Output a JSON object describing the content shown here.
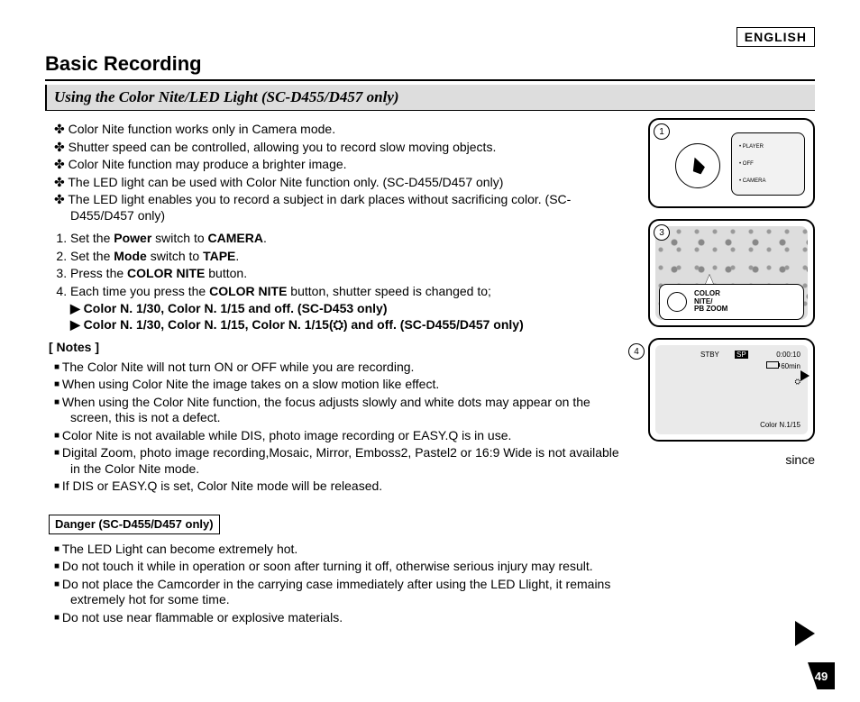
{
  "lang_label": "ENGLISH",
  "title": "Basic Recording",
  "subhead": "Using the Color Nite/LED Light (SC-D455/D457 only)",
  "intro_bullets": [
    "Color Nite function works only in Camera mode.",
    "Shutter speed can be controlled, allowing you to record slow moving objects.",
    "Color Nite function may produce a brighter image.",
    "The LED light can be used with Color Nite function only. (SC-D455/D457 only)",
    "The LED light enables you to record a subject in dark places without sacrificing color. (SC-D455/D457 only)"
  ],
  "steps": [
    {
      "pre": "Set the ",
      "b1": "Power",
      "mid": " switch to ",
      "b2": "CAMERA",
      "post": "."
    },
    {
      "pre": "Set the ",
      "b1": "Mode",
      "mid": " switch to ",
      "b2": "TAPE",
      "post": "."
    },
    {
      "pre": "Press the ",
      "b1": "COLOR NITE",
      "mid": "",
      "b2": "",
      "post": " button."
    },
    {
      "pre": "Each time you press the ",
      "b1": "COLOR NITE",
      "mid": "",
      "b2": "",
      "post": " button, shutter speed is changed to;"
    }
  ],
  "step4_sub": [
    "▶ Color N. 1/30, Color N. 1/15 and off. (SC-D453 only)",
    "▶ Color N. 1/30, Color N. 1/15, Color N. 1/15(⛭) and off. (SC-D455/D457 only)"
  ],
  "notes_head": "[ Notes ]",
  "notes": [
    "The Color Nite will not turn ON or OFF while you are recording.",
    "When using Color Nite the image takes on a slow motion like effect.",
    "When using the Color Nite function, the focus adjusts slowly and white dots may appear on the screen, this is not a defect.",
    "Color Nite is not available while DIS, photo image recording or EASY.Q is in use.",
    "Digital Zoom, photo image recording,Mosaic, Mirror, Emboss2, Pastel2 or 16:9 Wide is not available in the Color Nite mode.",
    "If DIS or EASY.Q is set, Color Nite mode will be released."
  ],
  "danger_head": "Danger (SC-D455/D457 only)",
  "danger": [
    "The LED Light can become extremely hot.",
    "Do not touch it while in operation or soon after turning it off, otherwise serious injury may result.",
    "Do not place the Camcorder in the carrying case immediately after using the LED Llight, it remains extremely hot for some time.",
    "Do not use near flammable or explosive materials."
  ],
  "since": "since",
  "fig1": {
    "num": "1",
    "labels": [
      "PLAYER",
      "OFF",
      "CAMERA"
    ]
  },
  "fig3": {
    "num": "3",
    "button_label": "COLOR\nNITE/\nPB ZOOM"
  },
  "fig4": {
    "num": "4",
    "status": "STBY",
    "sp": "SP",
    "time": "0:00:10",
    "remain": "60min",
    "mode": "Color N.1/15"
  },
  "page_number": "49"
}
